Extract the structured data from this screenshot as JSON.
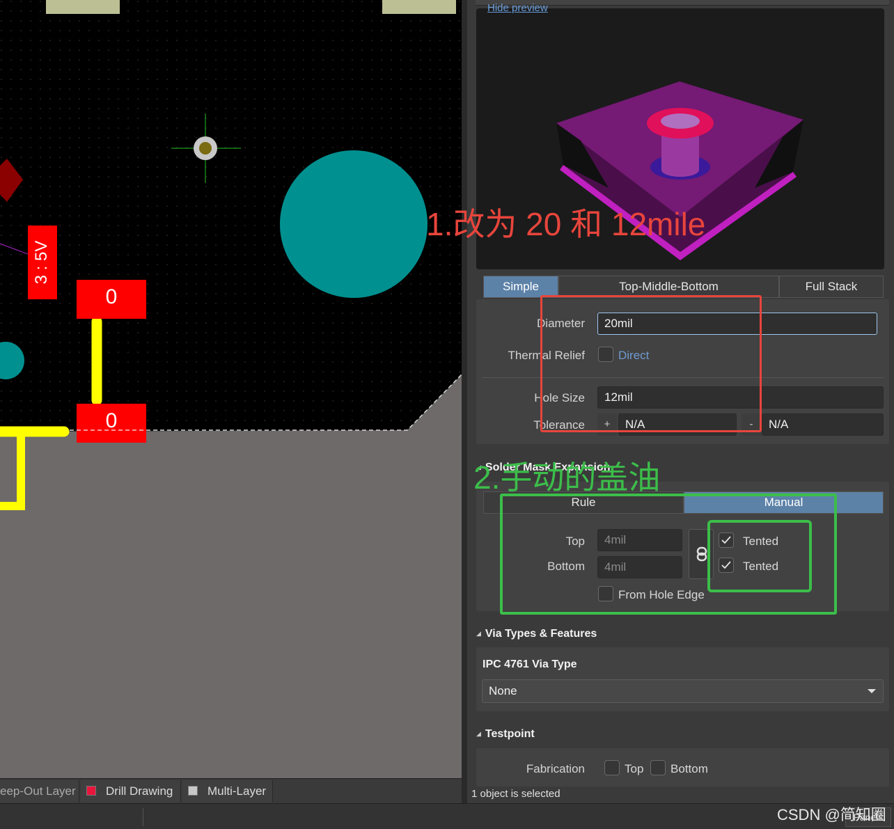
{
  "canvas": {
    "pad_labels": [
      "0",
      "0"
    ],
    "component_label": "3 : 5V"
  },
  "layer_tabs": [
    {
      "label": "eep-Out Layer",
      "color": ""
    },
    {
      "label": "Drill Drawing",
      "color": "#e8163c"
    },
    {
      "label": "Multi-Layer",
      "color": "#c8c8c8"
    }
  ],
  "properties": {
    "hide_preview_link": "Hide preview",
    "stack_modes": [
      "Simple",
      "Top-Middle-Bottom",
      "Full Stack"
    ],
    "active_stack_mode": "Simple",
    "diameter_label": "Diameter",
    "diameter_value": "20mil",
    "thermal_relief_label": "Thermal Relief",
    "thermal_relief_value": "Direct",
    "hole_size_label": "Hole Size",
    "hole_size_value": "12mil",
    "tolerance_label": "Tolerance",
    "tolerance_plus_sign": "+",
    "tolerance_plus_value": "N/A",
    "tolerance_minus_sign": "-",
    "tolerance_minus_value": "N/A",
    "solder_mask": {
      "title": "Solder Mask Expansion",
      "modes": [
        "Rule",
        "Manual"
      ],
      "active_mode": "Manual",
      "top_label": "Top",
      "top_value": "4mil",
      "bottom_label": "Bottom",
      "bottom_value": "4mil",
      "top_tented_label": "Tented",
      "top_tented_checked": true,
      "bottom_tented_label": "Tented",
      "bottom_tented_checked": true,
      "from_hole_edge_label": "From Hole Edge",
      "from_hole_edge_checked": false
    },
    "via_types": {
      "title": "Via Types & Features",
      "ipc_label": "IPC 4761 Via Type",
      "ipc_value": "None"
    },
    "testpoint": {
      "title": "Testpoint",
      "fabrication_label": "Fabrication",
      "top_label": "Top",
      "bottom_label": "Bottom"
    },
    "selection_status": "1 object is selected"
  },
  "annotations": {
    "note1": "1.改为 20 和 12mile",
    "note1_color": "#e8453c",
    "note2": "2.手动的盖油",
    "note2_color": "#3cbe4a"
  },
  "status_bar": {
    "panels_button": "Panels",
    "watermark": "CSDN @简知圈"
  },
  "colors": {
    "accent_blue": "#5d82a8",
    "canvas_bg": "#000000",
    "board_outline": "#6e6a6a",
    "pad_red": "#ff0000",
    "via_teal": "#009090",
    "track_yellow": "#ffff00"
  }
}
